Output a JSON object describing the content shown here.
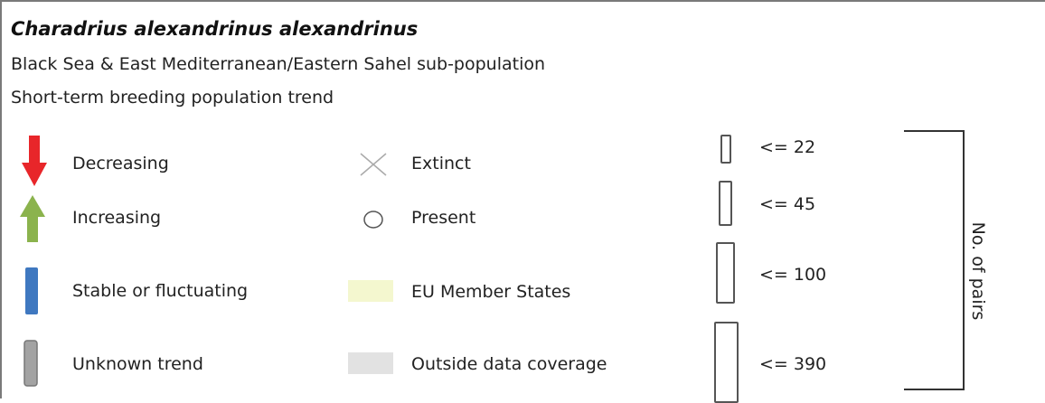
{
  "legend": {
    "title": "Charadrius alexandrinus alexandrinus",
    "subtitle": "Black Sea & East Mediterranean/Eastern Sahel sub-population",
    "metric": "Short-term breeding population trend",
    "trend_items": [
      {
        "label": "Decreasing",
        "icon": "red-down-arrow",
        "color": "#e8262a"
      },
      {
        "label": "Increasing",
        "icon": "green-up-arrow",
        "color": "#8bb34d"
      },
      {
        "label": "Stable or fluctuating",
        "icon": "blue-bar",
        "color": "#3f78c0"
      },
      {
        "label": "Unknown trend",
        "icon": "grey-bar",
        "color": "#a3a3a3"
      }
    ],
    "status_items": [
      {
        "label": "Extinct",
        "icon": "cross-icon"
      },
      {
        "label": "Present",
        "icon": "circle-icon"
      },
      {
        "label": "EU Member States",
        "icon": "swatch",
        "color": "#f4f7cf"
      },
      {
        "label": "Outside data coverage",
        "icon": "swatch",
        "color": "#e2e2e2"
      }
    ],
    "size_items": [
      {
        "label": "<= 22"
      },
      {
        "label": "<= 45"
      },
      {
        "label": "<= 100"
      },
      {
        "label": "<= 390"
      }
    ],
    "size_axis_label": "No. of pairs"
  }
}
